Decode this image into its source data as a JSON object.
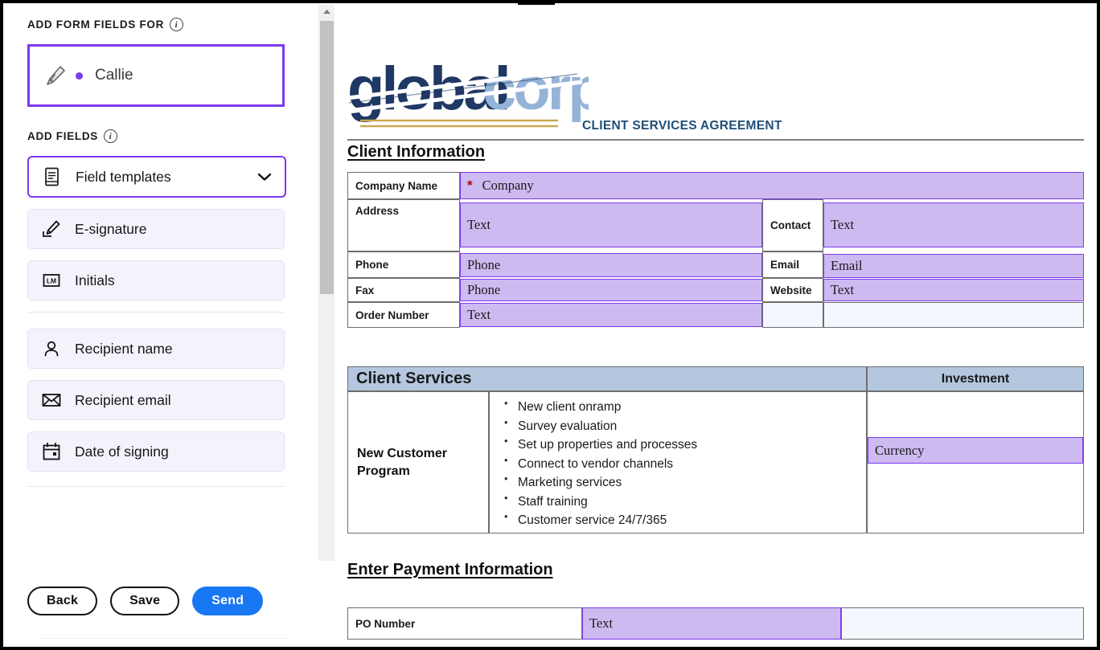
{
  "sidebar": {
    "section_recipients": {
      "title": "ADD FORM FIELDS FOR",
      "info_icon": "info-icon"
    },
    "recipient": {
      "name": "Callie",
      "icon": "pen-nib-icon",
      "dot_color": "#7c3aed"
    },
    "section_fields": {
      "title": "ADD FIELDS",
      "info_icon": "info-icon"
    },
    "field_buttons": [
      {
        "label": "Field templates",
        "icon": "document-icon",
        "selected": true,
        "chevron": "chevron-down-icon"
      },
      {
        "label": "E-signature",
        "icon": "esignature-icon",
        "selected": false
      },
      {
        "label": "Initials",
        "icon": "initials-icon",
        "selected": false
      }
    ],
    "recipient_buttons": [
      {
        "label": "Recipient name",
        "icon": "person-icon"
      },
      {
        "label": "Recipient email",
        "icon": "envelope-icon"
      },
      {
        "label": "Date of signing",
        "icon": "calendar-icon"
      }
    ],
    "footer": {
      "back_label": "Back",
      "save_label": "Save",
      "send_label": "Send",
      "send_color": "#1877f2"
    }
  },
  "scrollbar": {
    "up_icon": "scroll-up-arrow-icon"
  },
  "document": {
    "logo": {
      "word1": "global",
      "word2": "corp",
      "color1": "#1f3864",
      "color2": "#95b3d7",
      "rule_color": "#c8a951"
    },
    "subtitle": "CLIENT SERVICES AGREEMENT",
    "subtitle_color": "#1f4e79",
    "headings": {
      "client_information": "Client Information",
      "payment": "Enter Payment Information"
    },
    "client_info": {
      "company_name_label": "Company Name",
      "company_name_value": "Company",
      "company_required_marker": "*",
      "address_label": "Address",
      "address_value": "Text",
      "contact_label": "Contact",
      "contact_value": "Text",
      "phone_label": "Phone",
      "phone_value": "Phone",
      "email_label": "Email",
      "email_value": "Email",
      "fax_label": "Fax",
      "fax_value": "Phone",
      "website_label": "Website",
      "website_value": "Text",
      "order_number_label": "Order Number",
      "order_number_value": "Text"
    },
    "services": {
      "header": "Client Services",
      "investment_header": "Investment",
      "program_name": "New Customer Program",
      "items": [
        "New client onramp",
        "Survey evaluation",
        "Set up properties and processes",
        "Connect to vendor channels",
        "Marketing services",
        "Staff training",
        "Customer service 24/7/365"
      ],
      "investment_value": "Currency"
    },
    "payment": {
      "po_number_label": "PO Number",
      "po_number_value": "Text"
    },
    "field_fill_color": "#cdbaf0",
    "field_border_color": "#7c3aed",
    "table_header_color": "#b5c7de"
  }
}
